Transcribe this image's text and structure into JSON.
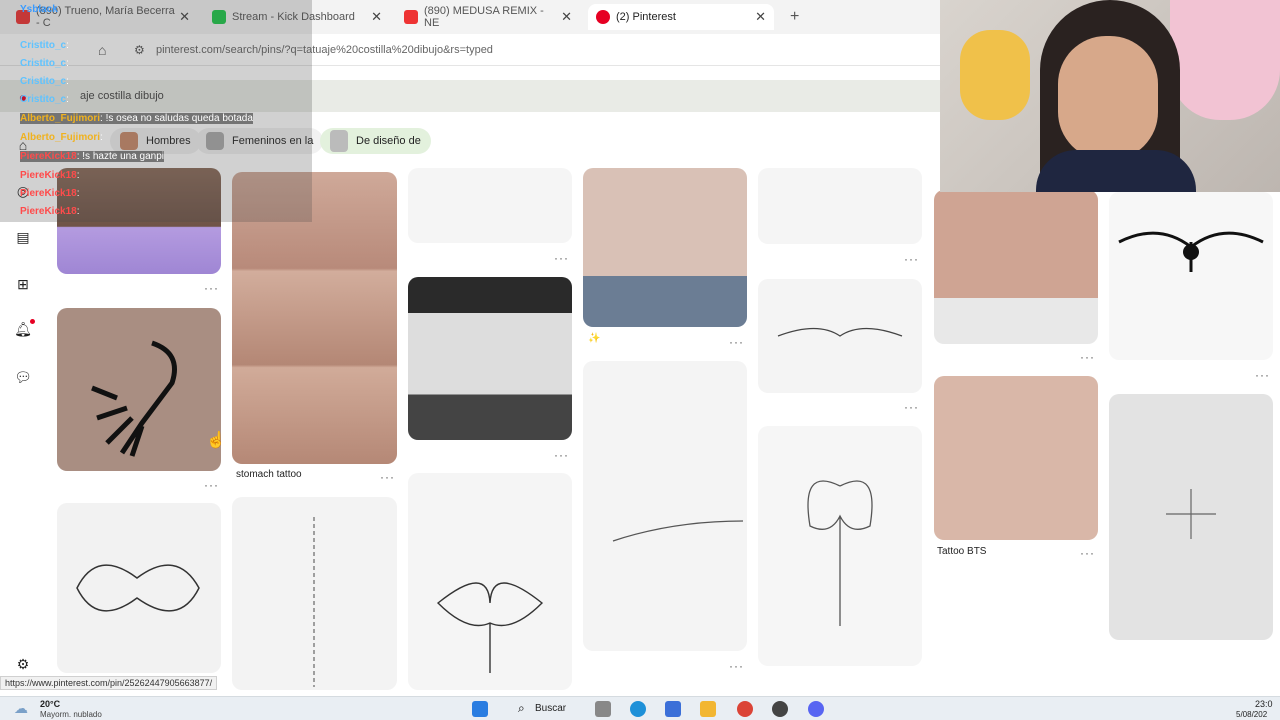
{
  "browser": {
    "tabs": [
      {
        "title": "(890) Trueno, María Becerra - C",
        "color": "#e33"
      },
      {
        "title": "Stream - Kick Dashboard",
        "color": "#1ec84a"
      },
      {
        "title": "(890) MEDUSA REMIX - NE",
        "color": "#e33"
      },
      {
        "title": "(2) Pinterest",
        "color": "#e60023"
      }
    ],
    "new_tab": "+",
    "url": "pinterest.com/search/pins/?q=tatuaje%20costilla%20dibujo&rs=typed"
  },
  "pinterest": {
    "search_value": "aje costilla dibujo",
    "chips": [
      "Hombres",
      "Femeninos en la",
      "De diseño de"
    ],
    "captions": {
      "stomach": "stomach tattoo",
      "bts": "Tattoo BTS"
    },
    "more": "···"
  },
  "chat": {
    "lines": [
      {
        "user": "Ysblack",
        "msg": "",
        "color": "#3a9bff"
      },
      {
        "user": "Cristito_c",
        "msg": ":",
        "color": "#5fc3ff"
      },
      {
        "user": "Cristito_c",
        "msg": ":",
        "color": "#5fc3ff"
      },
      {
        "user": "Cristito_c",
        "msg": ":",
        "color": "#5fc3ff"
      },
      {
        "user": "Cristito_c",
        "msg": ":",
        "color": "#5fc3ff"
      },
      {
        "user": "Cristito_c",
        "msg": ":",
        "color": "#5fc3ff"
      },
      {
        "user": "Alberto_Fujimori",
        "msg": ": !s osea no saludas queda botada",
        "color": "#f0b21f"
      },
      {
        "user": "Alberto_Fujimori",
        "msg": ":",
        "color": "#f0b21f"
      },
      {
        "user": "PiereKick18",
        "msg": ": !s hazte una ganpi",
        "color": "#ff4b4b"
      },
      {
        "user": "PiereKick18",
        "msg": ":",
        "color": "#ff4b4b"
      },
      {
        "user": "PiereKick18",
        "msg": ":",
        "color": "#ff4b4b"
      },
      {
        "user": "PiereKick18",
        "msg": ":",
        "color": "#ff4b4b"
      }
    ]
  },
  "status_url": "https://www.pinterest.com/pin/25262447905663877/",
  "taskbar": {
    "weather_temp": "20°C",
    "weather_desc": "Mayorm. nublado",
    "search": "Buscar",
    "time": "23:0",
    "date": "5/08/202"
  }
}
